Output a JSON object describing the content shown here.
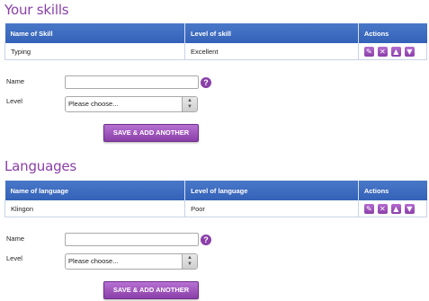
{
  "skills": {
    "title": "Your skills",
    "headers": [
      "Name of Skill",
      "Level of skill",
      "Actions"
    ],
    "rows": [
      {
        "name": "Typing",
        "level": "Excellent"
      }
    ],
    "form": {
      "name_label": "Name",
      "level_label": "Level",
      "select_value": "Please choose...",
      "button": "SAVE & ADD ANOTHER"
    }
  },
  "languages": {
    "title": "Languages",
    "headers": [
      "Name of language",
      "Level of language",
      "Actions"
    ],
    "rows": [
      {
        "name": "Klingon",
        "level": "Poor"
      }
    ],
    "form": {
      "name_label": "Name",
      "level_label": "Level",
      "select_value": "Please choose...",
      "button": "SAVE & ADD ANOTHER"
    }
  },
  "icons": {
    "edit": "pencil-icon",
    "delete": "x-icon",
    "up": "arrow-up-icon",
    "down": "arrow-down-icon",
    "help": "question-icon"
  },
  "colors": {
    "accent": "#8a3fa8",
    "header": "#3a67bd"
  }
}
